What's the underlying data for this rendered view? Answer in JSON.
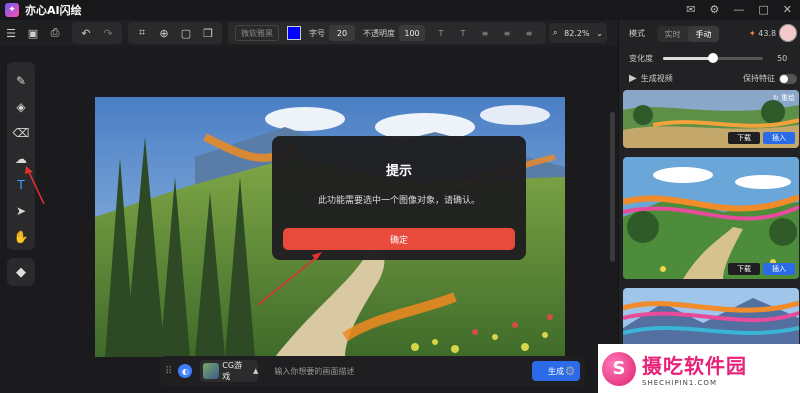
{
  "app": {
    "title": "亦心AI闪绘"
  },
  "window_controls": {
    "mail": "mail-icon",
    "settings": "gear-icon",
    "minimize": "—",
    "maximize": "□",
    "close": "✕"
  },
  "toolbar": {
    "font_name": "微软雅黑",
    "text_color": "#0000ff",
    "font_size_label": "字号",
    "font_size_value": "20",
    "opacity_label": "不透明度",
    "opacity_value": "100",
    "zoom": "82.2%"
  },
  "dialog": {
    "title": "提示",
    "message": "此功能需要选中一个图像对象，请确认。",
    "confirm_label": "确定"
  },
  "bottom_bar": {
    "style_name": "CG游戏",
    "prompt_placeholder": "输入你想要的画面描述",
    "generate_label": "生成"
  },
  "right_panel": {
    "mode_label": "模式",
    "mode_options": [
      "实时",
      "手动"
    ],
    "mode_selected": "手动",
    "credits": "43.8",
    "strength_label": "变化度",
    "strength_value": 50,
    "gen_video_label": "生成视频",
    "keep_features_label": "保持特征",
    "regen_label": "重绘",
    "download_label": "下载",
    "insert_label": "插入"
  },
  "watermark": {
    "cn": "摄吃软件园",
    "en": "SHECHIPIN1.COM"
  },
  "colors": {
    "accent_red": "#e84a3c",
    "accent_blue": "#2b6be8",
    "active_tool": "#3fa2ff"
  }
}
